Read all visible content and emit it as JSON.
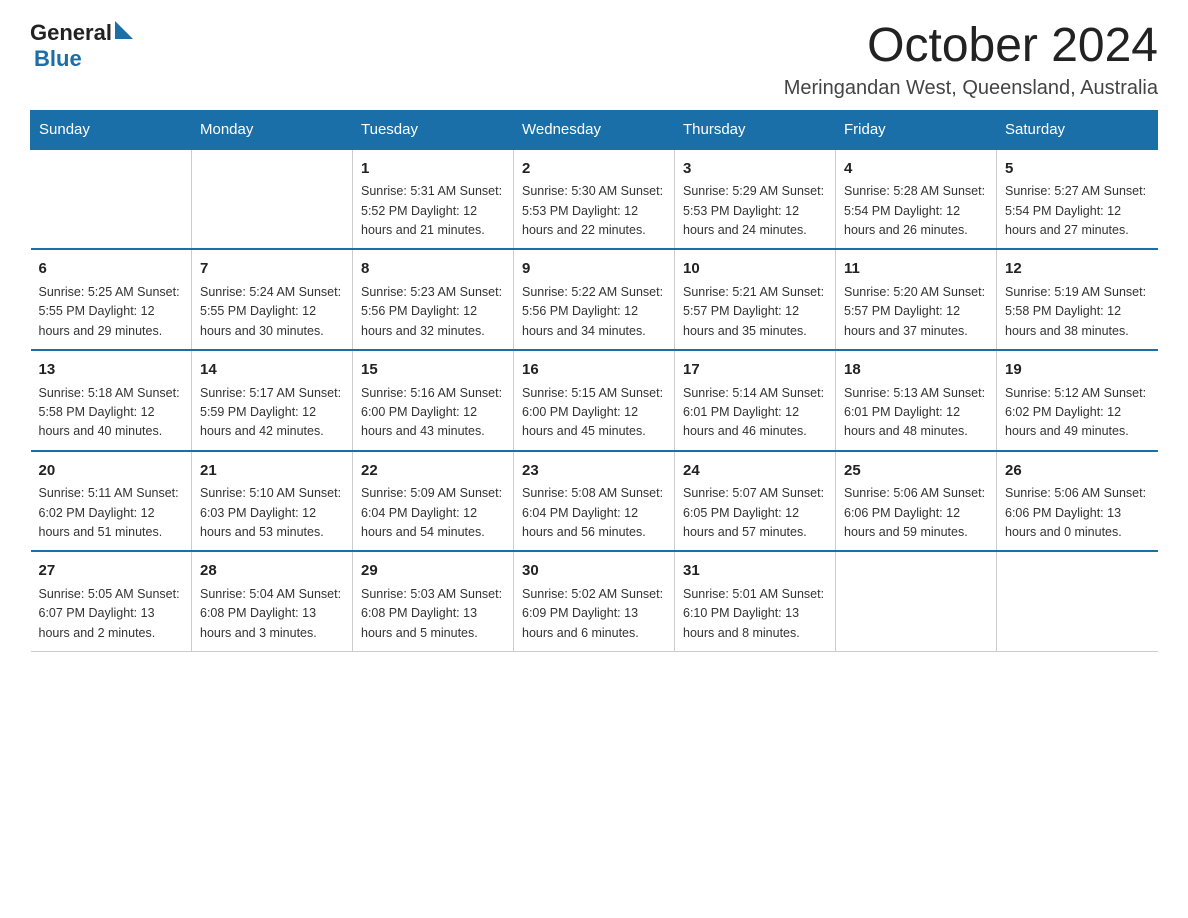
{
  "header": {
    "logo_general": "General",
    "logo_blue": "Blue",
    "month_year": "October 2024",
    "location": "Meringandan West, Queensland, Australia"
  },
  "days_of_week": [
    "Sunday",
    "Monday",
    "Tuesday",
    "Wednesday",
    "Thursday",
    "Friday",
    "Saturday"
  ],
  "weeks": [
    [
      {
        "day": "",
        "info": ""
      },
      {
        "day": "",
        "info": ""
      },
      {
        "day": "1",
        "info": "Sunrise: 5:31 AM\nSunset: 5:52 PM\nDaylight: 12 hours\nand 21 minutes."
      },
      {
        "day": "2",
        "info": "Sunrise: 5:30 AM\nSunset: 5:53 PM\nDaylight: 12 hours\nand 22 minutes."
      },
      {
        "day": "3",
        "info": "Sunrise: 5:29 AM\nSunset: 5:53 PM\nDaylight: 12 hours\nand 24 minutes."
      },
      {
        "day": "4",
        "info": "Sunrise: 5:28 AM\nSunset: 5:54 PM\nDaylight: 12 hours\nand 26 minutes."
      },
      {
        "day": "5",
        "info": "Sunrise: 5:27 AM\nSunset: 5:54 PM\nDaylight: 12 hours\nand 27 minutes."
      }
    ],
    [
      {
        "day": "6",
        "info": "Sunrise: 5:25 AM\nSunset: 5:55 PM\nDaylight: 12 hours\nand 29 minutes."
      },
      {
        "day": "7",
        "info": "Sunrise: 5:24 AM\nSunset: 5:55 PM\nDaylight: 12 hours\nand 30 minutes."
      },
      {
        "day": "8",
        "info": "Sunrise: 5:23 AM\nSunset: 5:56 PM\nDaylight: 12 hours\nand 32 minutes."
      },
      {
        "day": "9",
        "info": "Sunrise: 5:22 AM\nSunset: 5:56 PM\nDaylight: 12 hours\nand 34 minutes."
      },
      {
        "day": "10",
        "info": "Sunrise: 5:21 AM\nSunset: 5:57 PM\nDaylight: 12 hours\nand 35 minutes."
      },
      {
        "day": "11",
        "info": "Sunrise: 5:20 AM\nSunset: 5:57 PM\nDaylight: 12 hours\nand 37 minutes."
      },
      {
        "day": "12",
        "info": "Sunrise: 5:19 AM\nSunset: 5:58 PM\nDaylight: 12 hours\nand 38 minutes."
      }
    ],
    [
      {
        "day": "13",
        "info": "Sunrise: 5:18 AM\nSunset: 5:58 PM\nDaylight: 12 hours\nand 40 minutes."
      },
      {
        "day": "14",
        "info": "Sunrise: 5:17 AM\nSunset: 5:59 PM\nDaylight: 12 hours\nand 42 minutes."
      },
      {
        "day": "15",
        "info": "Sunrise: 5:16 AM\nSunset: 6:00 PM\nDaylight: 12 hours\nand 43 minutes."
      },
      {
        "day": "16",
        "info": "Sunrise: 5:15 AM\nSunset: 6:00 PM\nDaylight: 12 hours\nand 45 minutes."
      },
      {
        "day": "17",
        "info": "Sunrise: 5:14 AM\nSunset: 6:01 PM\nDaylight: 12 hours\nand 46 minutes."
      },
      {
        "day": "18",
        "info": "Sunrise: 5:13 AM\nSunset: 6:01 PM\nDaylight: 12 hours\nand 48 minutes."
      },
      {
        "day": "19",
        "info": "Sunrise: 5:12 AM\nSunset: 6:02 PM\nDaylight: 12 hours\nand 49 minutes."
      }
    ],
    [
      {
        "day": "20",
        "info": "Sunrise: 5:11 AM\nSunset: 6:02 PM\nDaylight: 12 hours\nand 51 minutes."
      },
      {
        "day": "21",
        "info": "Sunrise: 5:10 AM\nSunset: 6:03 PM\nDaylight: 12 hours\nand 53 minutes."
      },
      {
        "day": "22",
        "info": "Sunrise: 5:09 AM\nSunset: 6:04 PM\nDaylight: 12 hours\nand 54 minutes."
      },
      {
        "day": "23",
        "info": "Sunrise: 5:08 AM\nSunset: 6:04 PM\nDaylight: 12 hours\nand 56 minutes."
      },
      {
        "day": "24",
        "info": "Sunrise: 5:07 AM\nSunset: 6:05 PM\nDaylight: 12 hours\nand 57 minutes."
      },
      {
        "day": "25",
        "info": "Sunrise: 5:06 AM\nSunset: 6:06 PM\nDaylight: 12 hours\nand 59 minutes."
      },
      {
        "day": "26",
        "info": "Sunrise: 5:06 AM\nSunset: 6:06 PM\nDaylight: 13 hours\nand 0 minutes."
      }
    ],
    [
      {
        "day": "27",
        "info": "Sunrise: 5:05 AM\nSunset: 6:07 PM\nDaylight: 13 hours\nand 2 minutes."
      },
      {
        "day": "28",
        "info": "Sunrise: 5:04 AM\nSunset: 6:08 PM\nDaylight: 13 hours\nand 3 minutes."
      },
      {
        "day": "29",
        "info": "Sunrise: 5:03 AM\nSunset: 6:08 PM\nDaylight: 13 hours\nand 5 minutes."
      },
      {
        "day": "30",
        "info": "Sunrise: 5:02 AM\nSunset: 6:09 PM\nDaylight: 13 hours\nand 6 minutes."
      },
      {
        "day": "31",
        "info": "Sunrise: 5:01 AM\nSunset: 6:10 PM\nDaylight: 13 hours\nand 8 minutes."
      },
      {
        "day": "",
        "info": ""
      },
      {
        "day": "",
        "info": ""
      }
    ]
  ]
}
